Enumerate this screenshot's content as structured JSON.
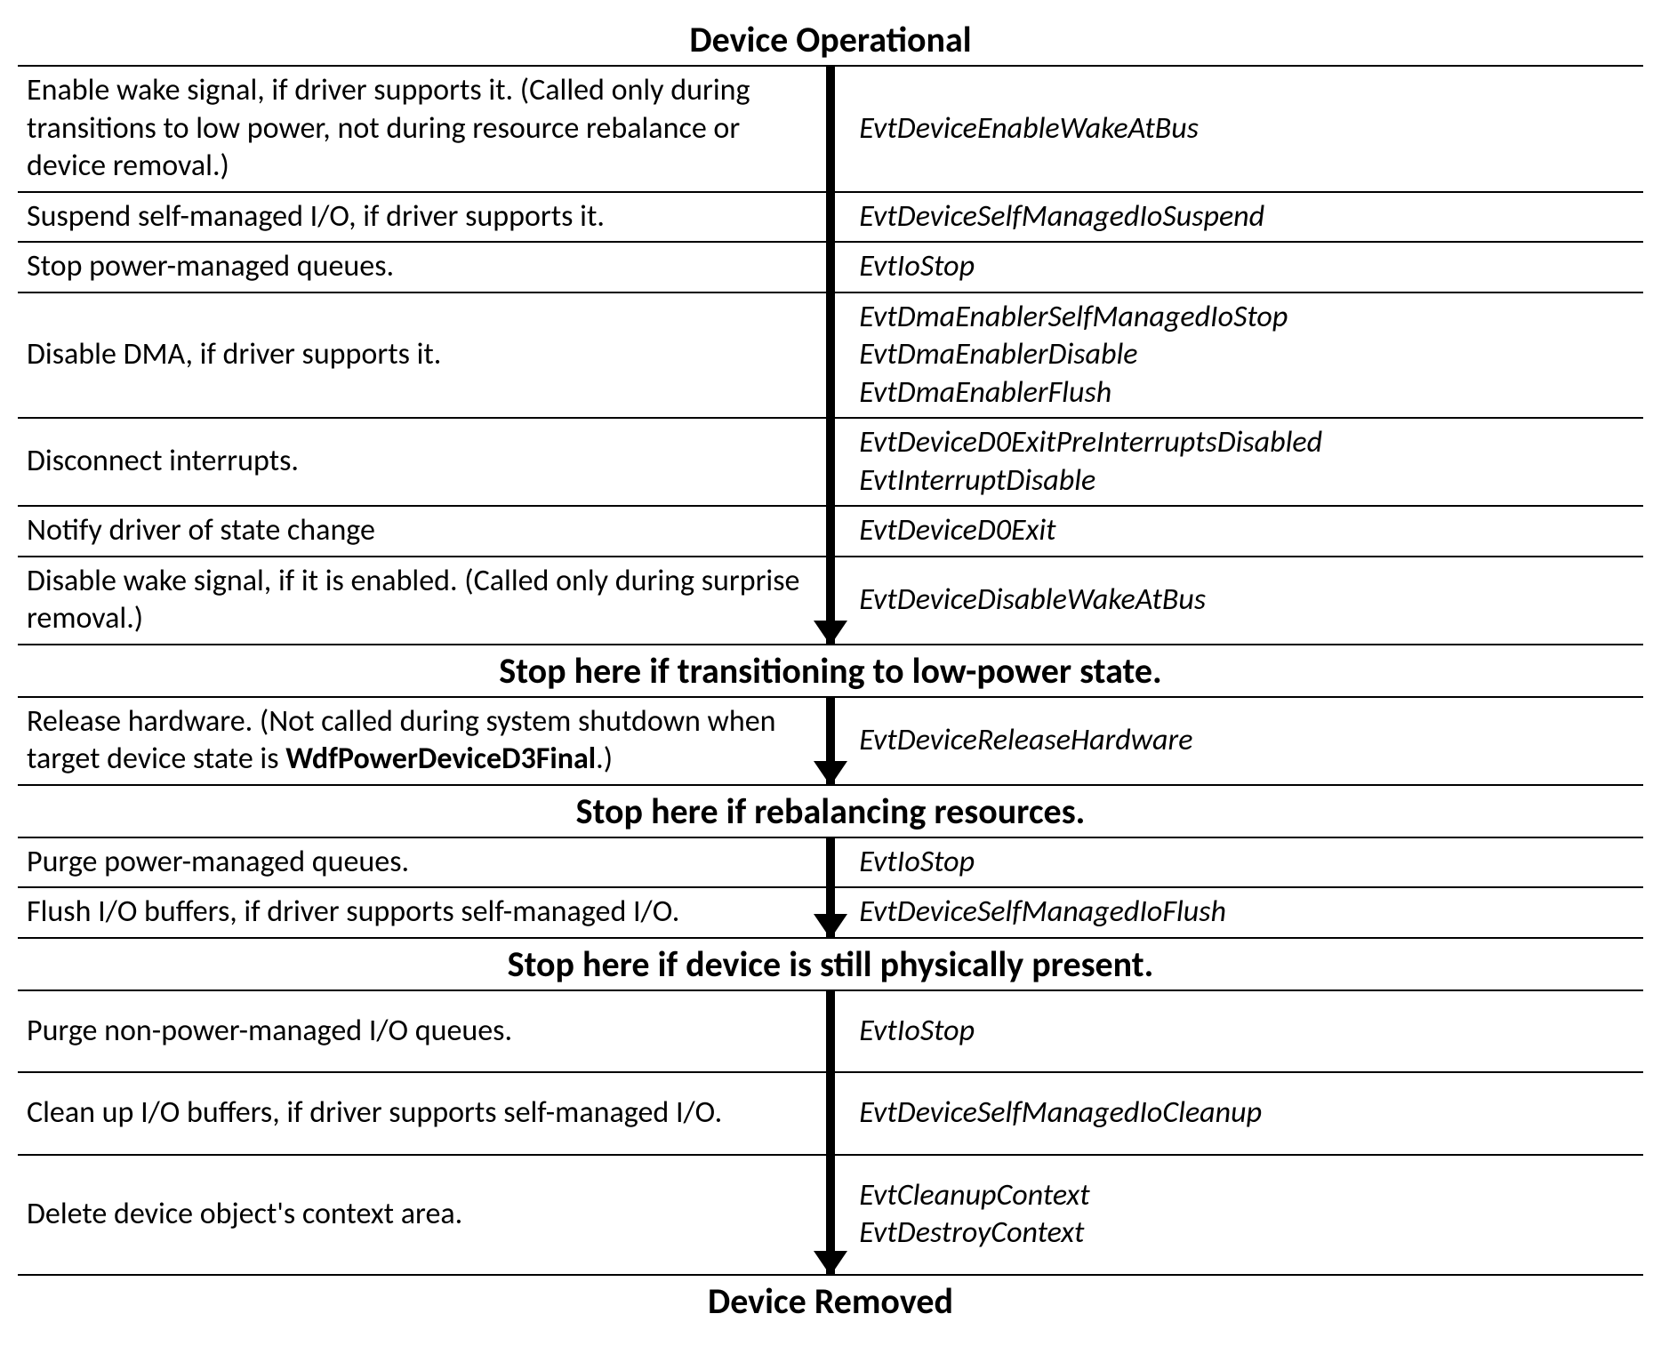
{
  "title_top": "Device Operational",
  "title_bottom": "Device Removed",
  "rows": [
    {
      "action": "Enable wake signal, if driver supports it. (Called only during transitions to low power, not during resource rebalance or device removal.)",
      "callbacks": [
        "EvtDeviceEnableWakeAtBus"
      ]
    },
    {
      "action": "Suspend self-managed I/O, if driver supports it.",
      "callbacks": [
        "EvtDeviceSelfManagedIoSuspend"
      ]
    },
    {
      "action": "Stop power-managed queues.",
      "callbacks": [
        "EvtIoStop"
      ]
    },
    {
      "action": "Disable DMA, if driver supports it.",
      "callbacks": [
        "EvtDmaEnablerSelfManagedIoStop",
        "EvtDmaEnablerDisable",
        "EvtDmaEnablerFlush"
      ]
    },
    {
      "action": "Disconnect interrupts.",
      "callbacks": [
        "EvtDeviceD0ExitPreInterruptsDisabled",
        "EvtInterruptDisable"
      ]
    },
    {
      "action": "Notify driver of state change",
      "callbacks": [
        "EvtDeviceD0Exit"
      ]
    },
    {
      "action": "Disable wake signal, if it is enabled. (Called only during surprise removal.)",
      "callbacks": [
        "EvtDeviceDisableWakeAtBus"
      ]
    }
  ],
  "break1": "Stop here if transitioning to low-power state.",
  "rows2": [
    {
      "action_pre": "Release hardware. (Not called during system shutdown when target device state is ",
      "action_bold": "WdfPowerDeviceD3Final",
      "action_post": ".)",
      "callbacks": [
        "EvtDeviceReleaseHardware"
      ]
    }
  ],
  "break2": "Stop here if rebalancing resources.",
  "rows3": [
    {
      "action": "Purge power-managed queues.",
      "callbacks": [
        "EvtIoStop"
      ]
    },
    {
      "action": "Flush I/O buffers, if driver supports self-managed I/O.",
      "callbacks": [
        "EvtDeviceSelfManagedIoFlush"
      ]
    }
  ],
  "break3": "Stop here if device is still physically present.",
  "rows4": [
    {
      "action": "Purge non-power-managed I/O queues.",
      "callbacks": [
        "EvtIoStop"
      ]
    },
    {
      "action": "Clean up I/O buffers, if driver supports self-managed I/O.",
      "callbacks": [
        "EvtDeviceSelfManagedIoCleanup"
      ]
    },
    {
      "action": "Delete device object's context area.",
      "callbacks": [
        "EvtCleanupContext",
        "EvtDestroyContext"
      ]
    }
  ]
}
